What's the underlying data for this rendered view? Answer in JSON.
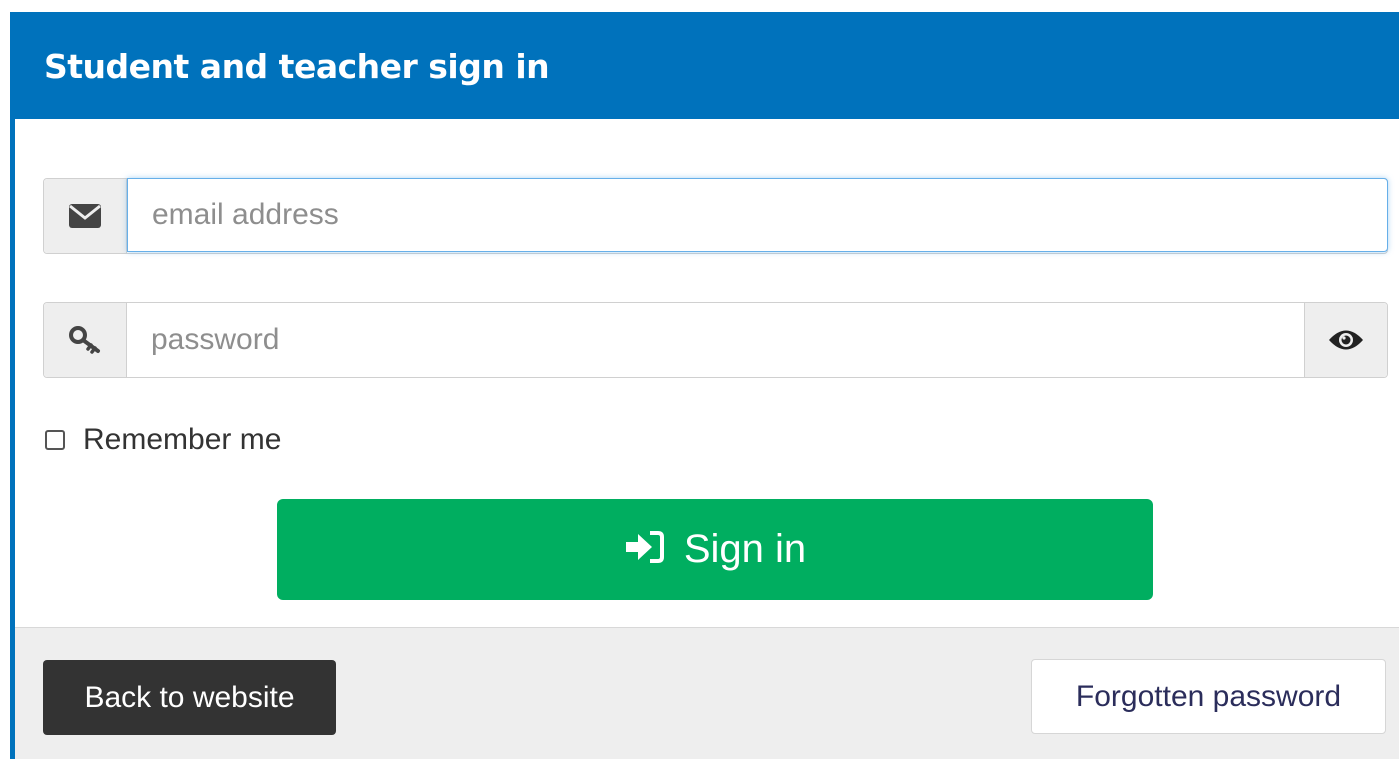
{
  "header": {
    "title": "Student and teacher sign in"
  },
  "email": {
    "placeholder": "email address",
    "value": "",
    "icon": "envelope-icon"
  },
  "password": {
    "placeholder": "password",
    "value": "",
    "icon": "key-icon",
    "toggle_icon": "eye-icon"
  },
  "remember": {
    "label": "Remember me",
    "checked": false
  },
  "signin": {
    "label": "Sign in",
    "icon": "sign-in-icon",
    "color": "#00AE60"
  },
  "footer": {
    "back_label": "Back to website",
    "forgot_label": "Forgotten password"
  },
  "colors": {
    "brand": "#0072BC",
    "footer_bg": "#eeeeee",
    "back_btn": "#333333"
  }
}
